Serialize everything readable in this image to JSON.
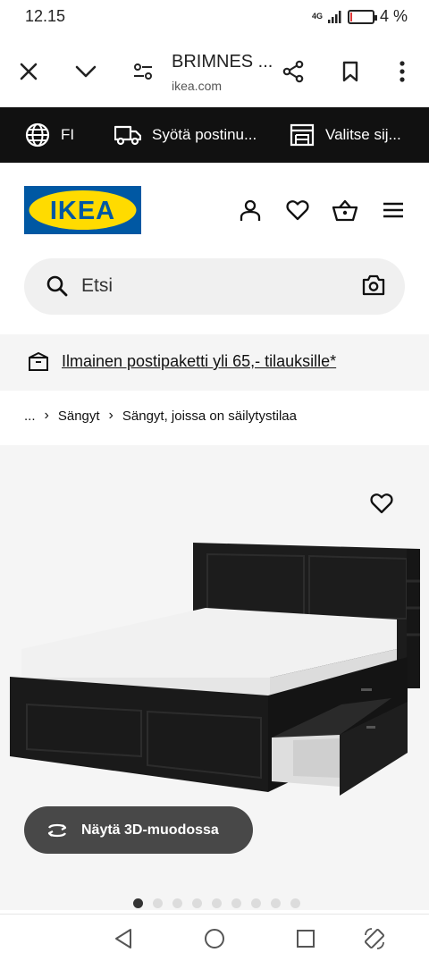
{
  "status": {
    "time": "12.15",
    "network": "4G",
    "battery": "4 %",
    "battery_level": 0.04
  },
  "browser": {
    "title": "BRIMNES ...",
    "url": "ikea.com"
  },
  "util_bar": {
    "language": "FI",
    "postcode": "Syötä postinu...",
    "store": "Valitse sij..."
  },
  "header": {
    "logo_text": "IKEA",
    "brand_blue": "#0058a3",
    "brand_yellow": "#ffdb00"
  },
  "search": {
    "placeholder": "Etsi"
  },
  "promo": {
    "text": "Ilmainen postipaketti yli 65,- tilauksille*"
  },
  "breadcrumb": {
    "ellipsis": "...",
    "items": [
      "Sängyt",
      "Sängyt, joissa on säilytystilaa"
    ]
  },
  "product": {
    "view_3d_label": "Näytä 3D-muodossa",
    "image_count": 9,
    "active_image": 0
  }
}
